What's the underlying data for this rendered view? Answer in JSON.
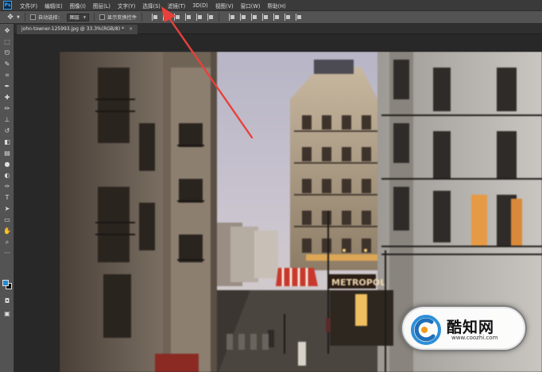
{
  "menubar": {
    "app_logo": "Ps",
    "items": [
      "文件(F)",
      "编辑(E)",
      "图像(I)",
      "图层(L)",
      "文字(Y)",
      "选择(S)",
      "滤镜(T)",
      "3D(D)",
      "视图(V)",
      "窗口(W)",
      "帮助(H)"
    ]
  },
  "options": {
    "auto_select_label": "自动选择：",
    "auto_select_value": "图层",
    "show_transform_label": "显示变换控件"
  },
  "document": {
    "tab_title": "john-towner-125993.jpg @ 33.3%(RGB/8) *",
    "close_glyph": "×"
  },
  "tools": [
    {
      "name": "move-tool-icon",
      "glyph": "✥"
    },
    {
      "name": "marquee-tool-icon",
      "glyph": "⬚"
    },
    {
      "name": "lasso-tool-icon",
      "glyph": "ᘎ"
    },
    {
      "name": "quick-select-tool-icon",
      "glyph": "✎"
    },
    {
      "name": "crop-tool-icon",
      "glyph": "⌗"
    },
    {
      "name": "eyedropper-tool-icon",
      "glyph": "✒"
    },
    {
      "name": "healing-brush-tool-icon",
      "glyph": "✚"
    },
    {
      "name": "brush-tool-icon",
      "glyph": "✏"
    },
    {
      "name": "clone-stamp-tool-icon",
      "glyph": "⊥"
    },
    {
      "name": "history-brush-tool-icon",
      "glyph": "↺"
    },
    {
      "name": "eraser-tool-icon",
      "glyph": "◧"
    },
    {
      "name": "gradient-tool-icon",
      "glyph": "▤"
    },
    {
      "name": "blur-tool-icon",
      "glyph": "●"
    },
    {
      "name": "dodge-tool-icon",
      "glyph": "◐"
    },
    {
      "name": "pen-tool-icon",
      "glyph": "✑"
    },
    {
      "name": "type-tool-icon",
      "glyph": "T"
    },
    {
      "name": "path-select-tool-icon",
      "glyph": "➤"
    },
    {
      "name": "rectangle-tool-icon",
      "glyph": "▭"
    },
    {
      "name": "hand-tool-icon",
      "glyph": "✋"
    },
    {
      "name": "zoom-tool-icon",
      "glyph": "⌕"
    },
    {
      "name": "more-tools-icon",
      "glyph": "···"
    }
  ],
  "colors": {
    "foreground": "#1e8cd6",
    "background": "#0a0a0a",
    "annotation_arrow": "#e8413c"
  },
  "watermark": {
    "title": "酷知网",
    "url": "www.coozhi.com"
  }
}
